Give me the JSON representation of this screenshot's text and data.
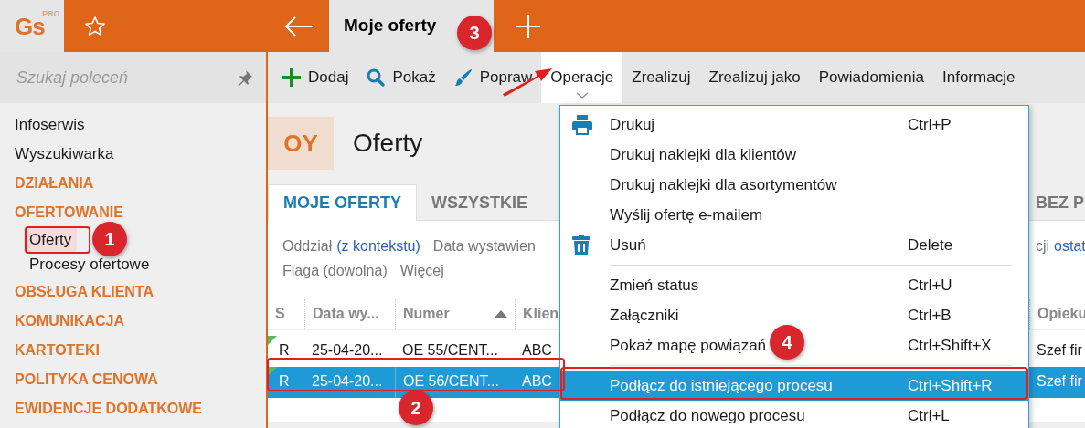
{
  "app": {
    "logo": "Gs",
    "logo_badge": "PRO"
  },
  "top_tab": {
    "label": "Moje oferty",
    "selected": true
  },
  "search": {
    "placeholder": "Szukaj poleceń"
  },
  "sidebar": {
    "items": [
      {
        "label": "Infoserwis",
        "kind": "link"
      },
      {
        "label": "Wyszukiwarka",
        "kind": "link"
      },
      {
        "label": "DZIAŁANIA",
        "kind": "section"
      },
      {
        "label": "OFERTOWANIE",
        "kind": "section",
        "children": [
          {
            "label": "Oferty",
            "selected": true
          },
          {
            "label": "Procesy ofertowe",
            "selected": false
          }
        ]
      },
      {
        "label": "OBSŁUGA KLIENTA",
        "kind": "section"
      },
      {
        "label": "KOMUNIKACJA",
        "kind": "section"
      },
      {
        "label": "KARTOTEKI",
        "kind": "section"
      },
      {
        "label": "POLITYKA CENOWA",
        "kind": "section"
      },
      {
        "label": "EWIDENCJE DODATKOWE",
        "kind": "section"
      }
    ]
  },
  "toolbar": [
    {
      "label": "Dodaj",
      "selected": false
    },
    {
      "label": "Pokaż",
      "selected": false
    },
    {
      "label": "Popraw",
      "selected": false
    },
    {
      "label": "Operacje",
      "selected": true
    },
    {
      "label": "Zrealizuj",
      "selected": false
    },
    {
      "label": "Zrealizuj jako",
      "selected": false
    },
    {
      "label": "Powiadomienia",
      "selected": false
    },
    {
      "label": "Informacje",
      "selected": false
    }
  ],
  "module": {
    "code": "OY",
    "title": "Oferty"
  },
  "tabs": [
    {
      "label": "MOJE OFERTY",
      "selected": true
    },
    {
      "label": "WSZYSTKIE",
      "selected": false
    }
  ],
  "tab_fragment": {
    "label": "BEZ P",
    "selected": false
  },
  "filters": [
    [
      {
        "text": "Oddział",
        "kind": "label"
      },
      {
        "text": "(z kontekstu)",
        "kind": "link"
      },
      {
        "text": "Data wystawien",
        "kind": "label"
      }
    ],
    [
      {
        "text": "Flaga (dowolna)",
        "kind": "label"
      },
      {
        "text": "Więcej",
        "kind": "label"
      }
    ]
  ],
  "filters_right": [
    {
      "text": "cji",
      "kind": "label"
    },
    {
      "text": "ostat",
      "kind": "link"
    }
  ],
  "table": {
    "columns": [
      {
        "label": "S"
      },
      {
        "label": "Data wy..."
      },
      {
        "label": "Numer",
        "sorted": true
      },
      {
        "label": "Klien"
      }
    ],
    "right_column": "Opieku",
    "rows": [
      {
        "cells": [
          "R",
          "25-04-20...",
          "OE 55/CENT...",
          "ABC"
        ],
        "right": "Szef fir",
        "selected": false,
        "flagged": true
      },
      {
        "cells": [
          "R",
          "25-04-20...",
          "OE 56/CENT...",
          "ABC"
        ],
        "right": "Szef fir",
        "selected": true,
        "flagged": true
      }
    ]
  },
  "menu": {
    "items": [
      {
        "kind": "item",
        "label": "Drukuj",
        "shortcut": "Ctrl+P",
        "selected": false
      },
      {
        "kind": "item",
        "label": "Drukuj naklejki dla klientów",
        "selected": false
      },
      {
        "kind": "item",
        "label": "Drukuj naklejki dla asortymentów",
        "selected": false
      },
      {
        "kind": "item",
        "label": "Wyślij ofertę e-mailem",
        "selected": false
      },
      {
        "kind": "item",
        "label": "Usuń",
        "shortcut": "Delete",
        "selected": false
      },
      {
        "kind": "separator"
      },
      {
        "kind": "item",
        "label": "Zmień status",
        "shortcut": "Ctrl+U",
        "selected": false
      },
      {
        "kind": "item",
        "label": "Załączniki",
        "shortcut": "Ctrl+B",
        "selected": false
      },
      {
        "kind": "item",
        "label": "Pokaż mapę powiązań",
        "shortcut": "Ctrl+Shift+X",
        "selected": false
      },
      {
        "kind": "separator"
      },
      {
        "kind": "item",
        "label": "Podłącz do istniejącego procesu",
        "shortcut": "Ctrl+Shift+R",
        "selected": true
      },
      {
        "kind": "item",
        "label": "Podłącz do nowego procesu",
        "shortcut": "Ctrl+L",
        "selected": false
      }
    ]
  },
  "callouts": [
    {
      "number": "1"
    },
    {
      "number": "2"
    },
    {
      "number": "3"
    },
    {
      "number": "4"
    }
  ]
}
